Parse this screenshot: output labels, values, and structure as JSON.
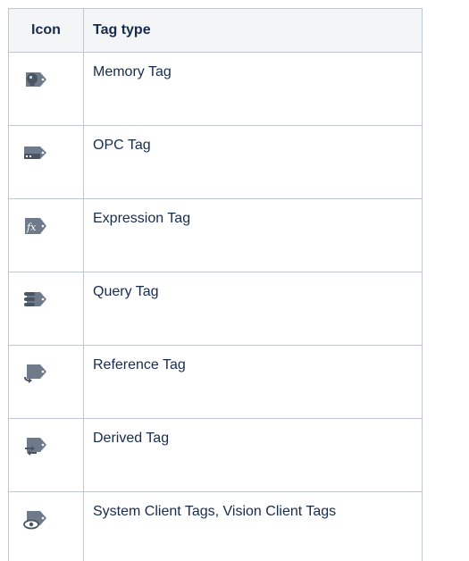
{
  "table": {
    "headers": {
      "icon": "Icon",
      "tag_type": "Tag type"
    },
    "rows": [
      {
        "icon": "memory-tag-icon",
        "label": "Memory Tag"
      },
      {
        "icon": "opc-tag-icon",
        "label": "OPC Tag"
      },
      {
        "icon": "expression-tag-icon",
        "label": "Expression Tag"
      },
      {
        "icon": "query-tag-icon",
        "label": "Query Tag"
      },
      {
        "icon": "reference-tag-icon",
        "label": "Reference Tag"
      },
      {
        "icon": "derived-tag-icon",
        "label": "Derived Tag"
      },
      {
        "icon": "client-tag-icon",
        "label": "System Client Tags, Vision Client Tags"
      }
    ]
  },
  "colors": {
    "tag_fill": "#6f7b8a",
    "tag_dark": "#4a5563",
    "border": "#c1c7d0",
    "header_bg": "#f4f5f7"
  }
}
